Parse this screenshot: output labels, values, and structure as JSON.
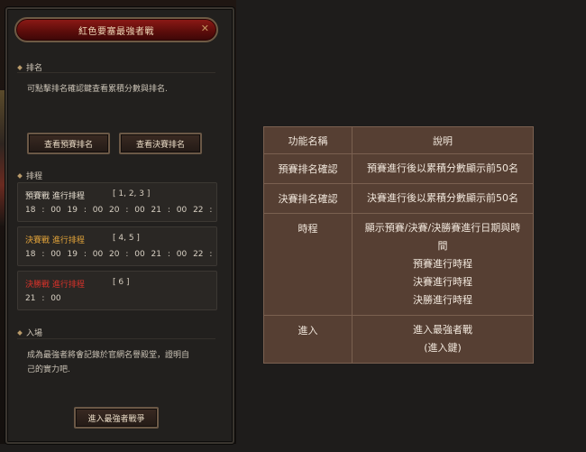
{
  "panel": {
    "title": "紅色要塞最強者戰",
    "close_icon": "✕",
    "ranking": {
      "heading": "排名",
      "description": "可點擊排名確認鍵查看累積分數與排名.",
      "btn_prelim": "查看預賽排名",
      "btn_final": "查看決賽排名"
    },
    "schedule": {
      "heading": "排程",
      "rows": [
        {
          "title": "預賽戰 進行排程",
          "days": "[ 1, 2, 3 ]",
          "times": "18 : 00   19 : 00   20 : 00   21 : 00   22 : 00   2",
          "color": "#e8e0d2"
        },
        {
          "title": "決賽戰 進行排程",
          "days": "[ 4, 5 ]",
          "times": "18 : 00   19 : 00   20 : 00   21 : 00   22 : 00   2",
          "color": "#e3a43a"
        },
        {
          "title": "決勝戰 進行排程",
          "days": "[ 6 ]",
          "times": "21 : 00",
          "color": "#d8322a"
        }
      ]
    },
    "entry": {
      "heading": "入場",
      "description_line1": "成為最強者將會記錄於官網名譽殿堂，證明自",
      "description_line2": "己的實力吧.",
      "btn_enter": "進入最強者戰爭"
    }
  },
  "table": {
    "headers": [
      "功能名稱",
      "說明"
    ],
    "rows": [
      {
        "name": "預賽排名確認",
        "lines": [
          "預賽進行後以累積分數顯示前50名"
        ]
      },
      {
        "name": "決賽排名確認",
        "lines": [
          "決賽進行後以累積分數顯示前50名"
        ]
      },
      {
        "name": "時程",
        "lines": [
          "顯示預賽/決賽/決勝賽進行日期與時",
          "間",
          "預賽進行時程",
          "決賽進行時程",
          "決勝進行時程"
        ]
      },
      {
        "name": "進入",
        "lines": [
          "進入最強者戰",
          "(進入鍵)"
        ]
      }
    ]
  }
}
